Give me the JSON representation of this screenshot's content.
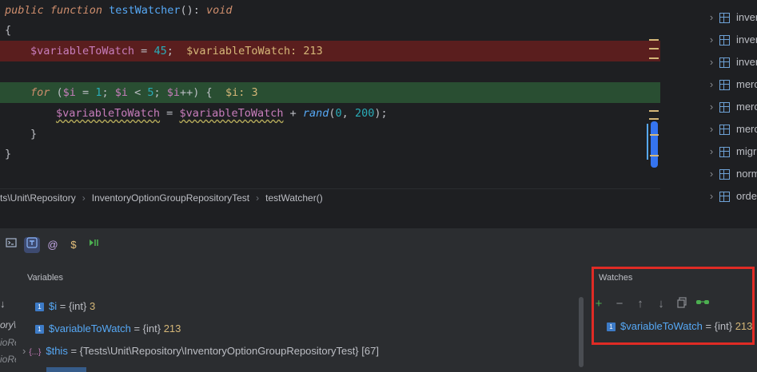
{
  "editor": {
    "line1": {
      "kw1": "public",
      "kw2": "function",
      "fn": "testWatcher",
      "rest": "(): ",
      "ret": "void"
    },
    "line2": "{",
    "line3": {
      "var": "$variableToWatch",
      "op": " = ",
      "num": "45",
      "semi": ";",
      "inline": "$variableToWatch: 213"
    },
    "line5": {
      "kw": "for",
      "p1": " (",
      "v1": "$i",
      "p2": " = ",
      "n1": "1",
      "p3": "; ",
      "v2": "$i",
      "p4": " < ",
      "n2": "5",
      "p5": "; ",
      "v3": "$i",
      "p6": "++) {",
      "inline": "$i: 3"
    },
    "line6": {
      "v1": "$variableToWatch",
      "op1": " = ",
      "v2": "$variableToWatch",
      "op2": " + ",
      "fn": "rand",
      "args1": "(",
      "n1": "0",
      "comma": ", ",
      "n2": "200",
      "args2": ");"
    },
    "line7": "}",
    "line8": "}"
  },
  "breadcrumb": {
    "items": [
      "ts\\Unit\\Repository",
      "InventoryOptionGroupRepositoryTest",
      "testWatcher()"
    ]
  },
  "tree": {
    "items": [
      "inver",
      "inver",
      "inver",
      "merc",
      "merc",
      "merc",
      "migr",
      "norm",
      "orde"
    ]
  },
  "toolbar": {
    "at_icon": "@",
    "dollar_icon": "$"
  },
  "variables": {
    "title": "Variables",
    "rows": [
      {
        "badge": "1",
        "name": "$i",
        "eq": " = {int} ",
        "value": "3"
      },
      {
        "badge": "1",
        "name": "$variableToWatch",
        "eq": " = {int} ",
        "value": "213"
      },
      {
        "badge": "{...}",
        "name": "$this",
        "eq": " = {Tests\\Unit\\Repository\\InventoryOptionGroupRepositoryTest} [67]",
        "value": ""
      }
    ],
    "left_frames": [
      "ory\\",
      "ioRe",
      "ioRe"
    ]
  },
  "watches": {
    "title": "Watches",
    "rows": [
      {
        "badge": "1",
        "name": "$variableToWatch",
        "eq": " = {int} ",
        "value": "213"
      }
    ]
  },
  "colors": {
    "error_line": "#5a1e1e",
    "exec_line": "#294e32",
    "highlight_box": "#e02b25"
  }
}
